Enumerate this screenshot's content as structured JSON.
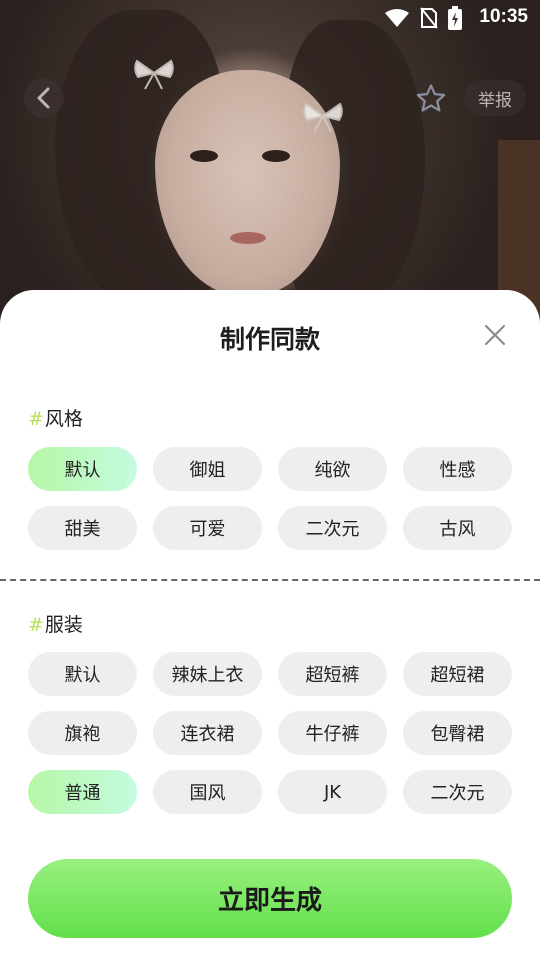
{
  "status_bar": {
    "time": "10:35",
    "icons": [
      "wifi-icon",
      "no-sim-icon",
      "battery-charging-icon"
    ]
  },
  "header": {
    "report_label": "举报"
  },
  "sheet": {
    "title": "制作同款",
    "style_section": {
      "hash": "#",
      "label": "风格",
      "options": [
        "默认",
        "御姐",
        "纯欲",
        "性感",
        "甜美",
        "可爱",
        "二次元",
        "古风"
      ],
      "selected": "默认"
    },
    "outfit_section": {
      "hash": "#",
      "label": "服装",
      "options": [
        "默认",
        "辣妹上衣",
        "超短裤",
        "超短裙",
        "旗袍",
        "连衣裙",
        "牛仔裤",
        "包臀裙",
        "普通",
        "国风",
        "JK",
        "二次元"
      ],
      "selected": "普通"
    },
    "generate_label": "立即生成"
  },
  "colors": {
    "accent_green": "#62e04a",
    "selected_chip": "#b6f7a6",
    "hash_color": "#b8e25a"
  }
}
